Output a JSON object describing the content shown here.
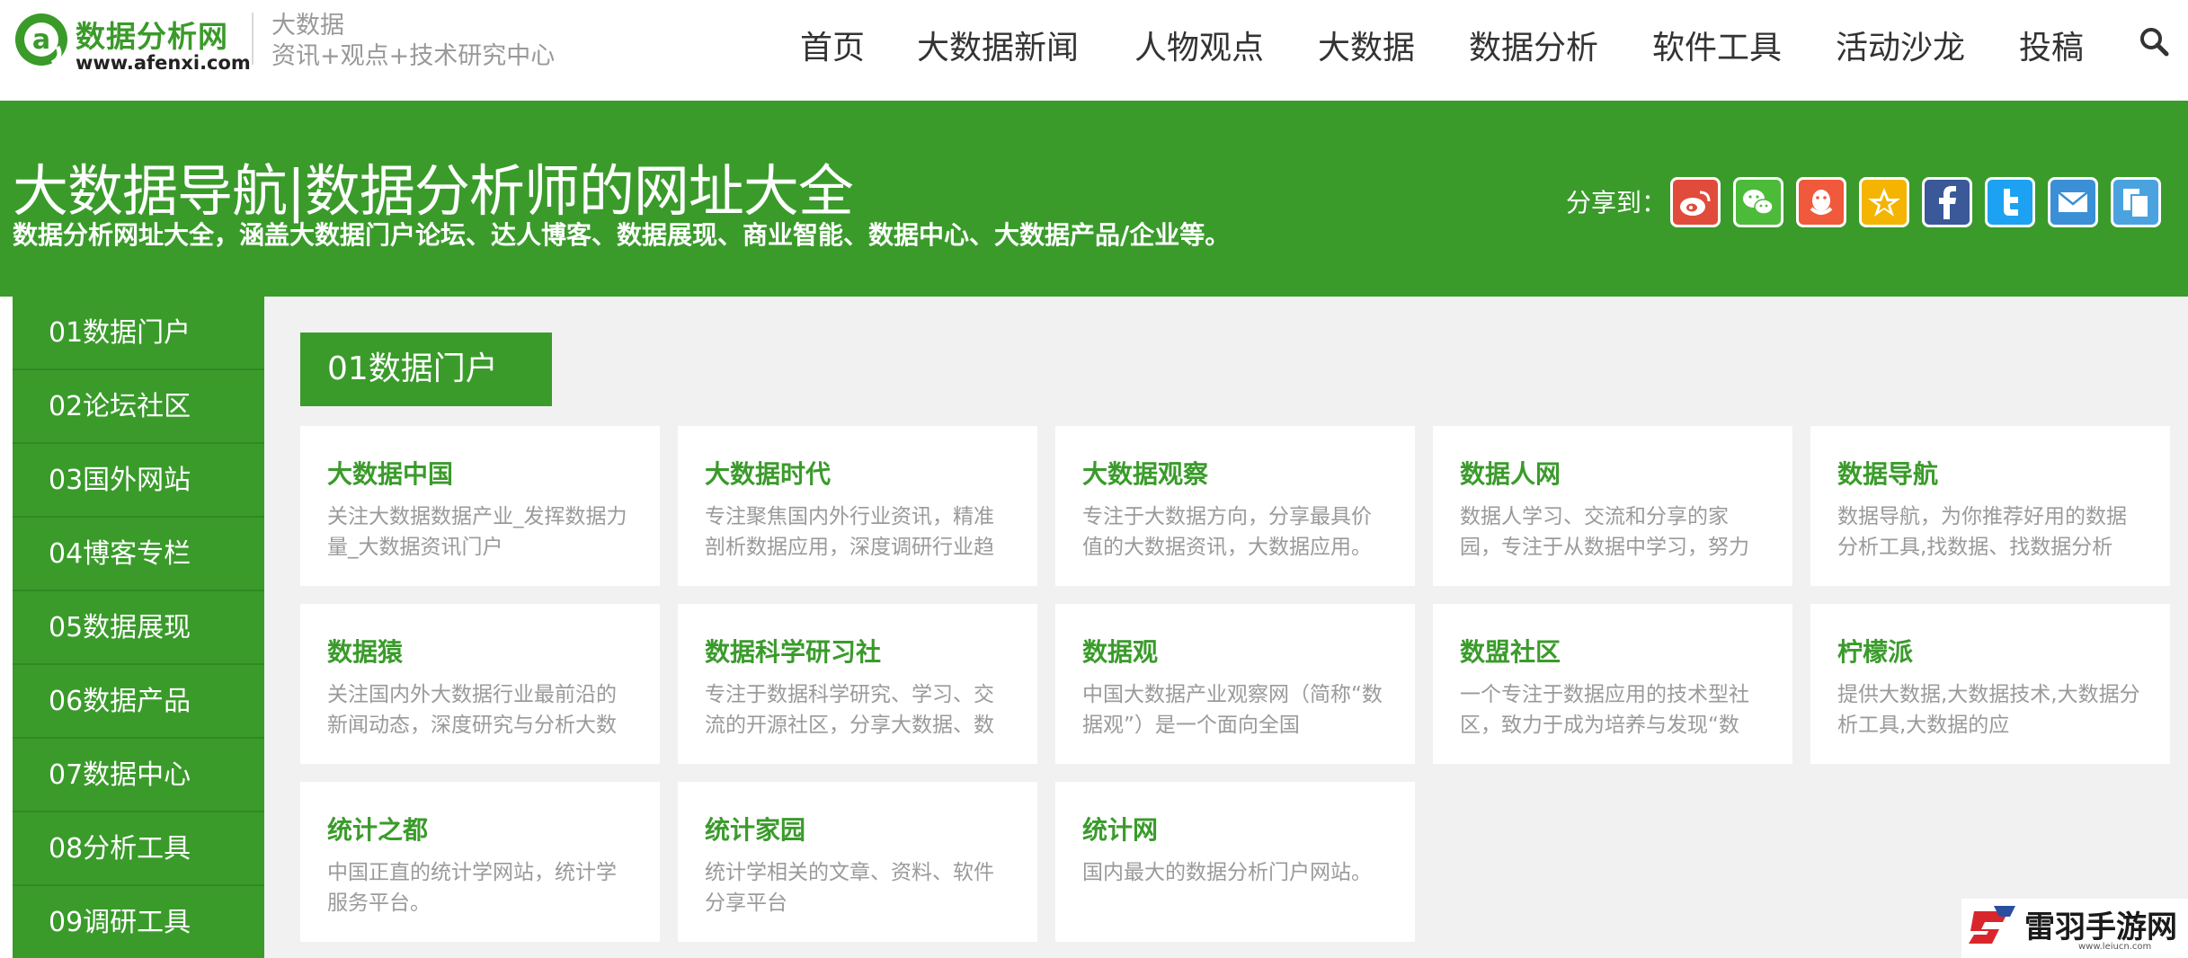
{
  "logo": {
    "name": "数据分析网",
    "url": "www.afenxi.com",
    "slogan_line1": "大数据",
    "slogan_line2": "资讯+观点+技术研究中心"
  },
  "nav": {
    "items": [
      "首页",
      "大数据新闻",
      "人物观点",
      "大数据",
      "数据分析",
      "软件工具",
      "活动沙龙",
      "投稿"
    ],
    "search_icon": "search-icon"
  },
  "banner": {
    "title": "大数据导航|数据分析师的网址大全",
    "subtitle": "数据分析网址大全，涵盖大数据门户论坛、达人博客、数据展现、商业智能、数据中心、大数据产品/企业等。",
    "share_label": "分享到：",
    "share_icons": [
      "weibo-icon",
      "wechat-icon",
      "qq-icon",
      "qzone-icon",
      "facebook-icon",
      "twitter-icon",
      "email-icon",
      "copy-icon"
    ],
    "share_colors": [
      "#e14b3b",
      "#4cbb3a",
      "#f0593b",
      "#f4b400",
      "#3b5998",
      "#1da1f2",
      "#3b8fd6",
      "#4aa3df"
    ]
  },
  "sidebar": {
    "items": [
      "01数据门户",
      "02论坛社区",
      "03国外网站",
      "04博客专栏",
      "05数据展现",
      "06数据产品",
      "07数据中心",
      "08分析工具",
      "09调研工具"
    ]
  },
  "main": {
    "section_title": "01数据门户",
    "cards": [
      {
        "title": "大数据中国",
        "desc": "关注大数据数据产业_发挥数据力量_大数据资讯门户"
      },
      {
        "title": "大数据时代",
        "desc": "专注聚焦国内外行业资讯，精准剖析数据应用，深度调研行业趋"
      },
      {
        "title": "大数据观察",
        "desc": "专注于大数据方向，分享最具价值的大数据资讯，大数据应用。"
      },
      {
        "title": "数据人网",
        "desc": "数据人学习、交流和分享的家园，专注于从数据中学习，努力"
      },
      {
        "title": "数据导航",
        "desc": "数据导航，为你推荐好用的数据分析工具,找数据、找数据分析"
      },
      {
        "title": "数据猿",
        "desc": "关注国内外大数据行业最前沿的新闻动态，深度研究与分析大数"
      },
      {
        "title": "数据科学研习社",
        "desc": "专注于数据科学研究、学习、交流的开源社区，分享大数据、数"
      },
      {
        "title": "数据观",
        "desc": "中国大数据产业观察网（简称“数据观”）是一个面向全国"
      },
      {
        "title": "数盟社区",
        "desc": "一个专注于数据应用的技术型社区，致力于成为培养与发现“数"
      },
      {
        "title": "柠檬派",
        "desc": "提供大数据,大数据技术,大数据分析工具,大数据的应"
      },
      {
        "title": "统计之都",
        "desc": "中国正直的统计学网站，统计学服务平台。"
      },
      {
        "title": "统计家园",
        "desc": "统计学相关的文章、资料、软件分享平台"
      },
      {
        "title": "统计网",
        "desc": "国内最大的数据分析门户网站。"
      }
    ]
  },
  "watermark": {
    "name": "雷羽手游网",
    "url": "www.leiucn.com"
  },
  "colors": {
    "brand_green": "#3a9b2b",
    "sidebar_divider": "#2f8a22",
    "main_bg": "#f1f1f1"
  }
}
